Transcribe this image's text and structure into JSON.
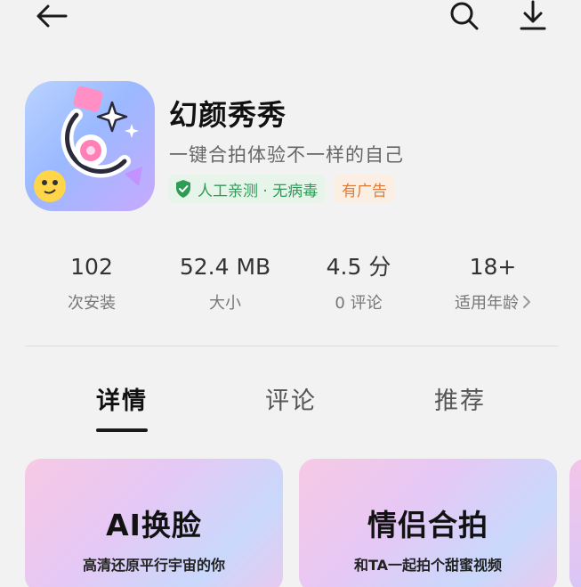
{
  "app": {
    "name": "幻颜秀秀",
    "slogan": "一键合拍体验不一样的自己",
    "safety_badge": "人工亲测 · 无病毒",
    "ad_badge": "有广告"
  },
  "stats": [
    {
      "value": "102",
      "label": "次安装"
    },
    {
      "value": "52.4 MB",
      "label": "大小"
    },
    {
      "value": "4.5 分",
      "label": "0 评论"
    },
    {
      "value": "18+",
      "label": "适用年龄"
    }
  ],
  "tabs": [
    {
      "label": "详情",
      "active": true
    },
    {
      "label": "评论",
      "active": false
    },
    {
      "label": "推荐",
      "active": false
    }
  ],
  "features": [
    {
      "title": "AI换脸",
      "subtitle": "高清还原平行宇宙的你"
    },
    {
      "title": "情侣合拍",
      "subtitle": "和TA一起拍个甜蜜视频"
    }
  ],
  "icons": {
    "back": "arrow-left-icon",
    "search": "search-icon",
    "download": "download-icon",
    "shield": "shield-check-icon",
    "chevron": "chevron-right-icon"
  },
  "colors": {
    "safe_green": "#2e9b56",
    "ad_orange": "#e07b39",
    "background": "#f2f2f2"
  }
}
